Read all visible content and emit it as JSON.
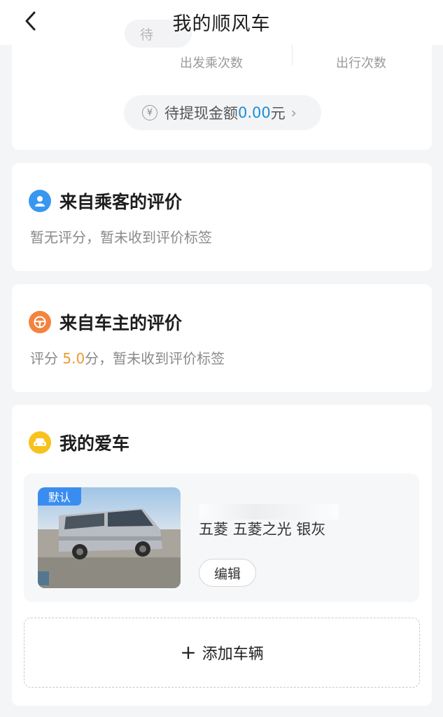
{
  "header": {
    "title": "我的顺风车",
    "pending_chip": "待"
  },
  "stats": {
    "left_label": "出发乘次数",
    "right_label": "出行次数",
    "withdraw": {
      "prefix": "待提现金额",
      "amount": "0.00",
      "suffix": "元"
    }
  },
  "passenger_review": {
    "title": "来自乘客的评价",
    "text": "暂无评分，暂未收到评价标签"
  },
  "owner_review": {
    "title": "来自车主的评价",
    "prefix": "评分 ",
    "score": "5.0",
    "suffix": "分，暂未收到评价标签"
  },
  "my_car": {
    "title": "我的爱车",
    "badge": "默认",
    "name": "五菱  五菱之光 银灰",
    "edit_label": "编辑",
    "add_label": "添加车辆"
  },
  "colors": {
    "accent_blue": "#1a8fd8",
    "score_orange": "#ee9a2e",
    "badge_blue": "#3a8df0"
  }
}
